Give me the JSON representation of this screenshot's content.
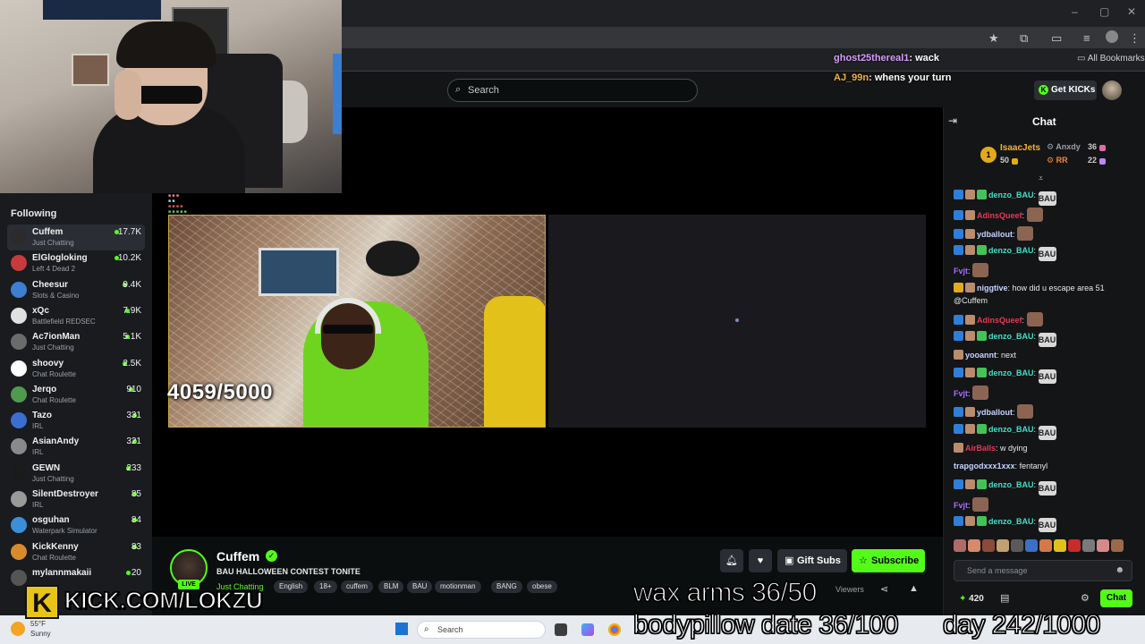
{
  "browser": {
    "bookmarks_label": "All Bookmarks",
    "window_controls": [
      "–",
      "▢",
      "✕"
    ]
  },
  "header": {
    "search_placeholder": "Search",
    "get_kicks_label": "Get KICKs"
  },
  "overlay_chat": [
    {
      "user": "ghost25thereal1",
      "message": "wack",
      "user_color": "#d99cff"
    },
    {
      "user": "AJ_99n",
      "message": "whens your turn",
      "user_color": "#f3b23a"
    }
  ],
  "sidebar": {
    "title": "Following",
    "items": [
      {
        "name": "Cuffem",
        "category": "Just Chatting",
        "viewers": "17.7K",
        "active": true,
        "avatar_color": "#2b2b2b"
      },
      {
        "name": "ElGlogloking",
        "category": "Left 4 Dead 2",
        "viewers": "10.2K",
        "avatar_color": "#c93a3a"
      },
      {
        "name": "Cheesur",
        "category": "Slots & Casino",
        "viewers": "9.4K",
        "avatar_color": "#3d7fd1"
      },
      {
        "name": "xQc",
        "category": "Battlefield REDSEC",
        "viewers": "7.9K",
        "avatar_color": "#e0e0e0"
      },
      {
        "name": "Ac7ionMan",
        "category": "Just Chatting",
        "viewers": "5.1K",
        "avatar_color": "#6b6b6b"
      },
      {
        "name": "shoovy",
        "category": "Chat Roulette",
        "viewers": "2.5K",
        "avatar_color": "#ffffff"
      },
      {
        "name": "Jerqo",
        "category": "Chat Roulette",
        "viewers": "910",
        "avatar_color": "#4f9a4f"
      },
      {
        "name": "Tazo",
        "category": "IRL",
        "viewers": "331",
        "avatar_color": "#3a6fd1"
      },
      {
        "name": "AsianAndy",
        "category": "IRL",
        "viewers": "321",
        "avatar_color": "#8a8a8a"
      },
      {
        "name": "GEWN",
        "category": "Just Chatting",
        "viewers": "233",
        "avatar_color": "#1a1a1a"
      },
      {
        "name": "SilentDestroyer",
        "category": "IRL",
        "viewers": "85",
        "avatar_color": "#9a9a9a"
      },
      {
        "name": "osguhan",
        "category": "Waterpark Simulator",
        "viewers": "84",
        "avatar_color": "#3b8fd9"
      },
      {
        "name": "KickKenny",
        "category": "Chat Roulette",
        "viewers": "83",
        "avatar_color": "#d98a2b"
      },
      {
        "name": "mylannmakaii",
        "category": "",
        "viewers": "20",
        "avatar_color": "#555555"
      }
    ]
  },
  "player": {
    "counter_text": "4059/5000"
  },
  "stream_info": {
    "channel_name": "Cuffem",
    "live_label": "LIVE",
    "title": "BAU HALLOWEEN CONTEST TONITE",
    "category": "Just Chatting",
    "tags": [
      "English",
      "18+",
      "cuffem",
      "BLM",
      "BAU",
      "motionman",
      "BANG",
      "obese"
    ],
    "gift_subs_label": "Gift Subs",
    "subscribe_label": "Subscribe",
    "viewers_label": "Viewers"
  },
  "chat": {
    "title": "Chat",
    "top_gifters": [
      {
        "name": "IsaacJets",
        "count": "50",
        "color": "#f3b23a"
      },
      {
        "name": "Anxdy",
        "count": "36",
        "color": "#9aa0a6"
      },
      {
        "name": "RR",
        "count": "22",
        "color": "#f08a3a"
      }
    ],
    "rank_badge": "1",
    "messages": [
      {
        "user": "denzo_BAU",
        "text": "",
        "user_class": "u-teal",
        "emote": "BAU"
      },
      {
        "user": "AdinsQueef",
        "text": "",
        "user_class": "u-red",
        "emote": "img"
      },
      {
        "user": "ydballout",
        "text": "",
        "user_class": "u-white",
        "emote": "img"
      },
      {
        "user": "denzo_BAU",
        "text": "",
        "user_class": "u-teal",
        "emote": "BAU"
      },
      {
        "user": "Fvjt",
        "text": "",
        "user_class": "u-purple",
        "emote": "img"
      },
      {
        "user": "niggtive",
        "text": "how did u escape area 51 @Cuffem",
        "user_class": "u-white",
        "emote": ""
      },
      {
        "user": "AdinsQueef",
        "text": "",
        "user_class": "u-red",
        "emote": "img"
      },
      {
        "user": "denzo_BAU",
        "text": "",
        "user_class": "u-teal",
        "emote": "BAU"
      },
      {
        "user": "yooannt",
        "text": "next",
        "user_class": "u-white",
        "emote": ""
      },
      {
        "user": "denzo_BAU",
        "text": "",
        "user_class": "u-teal",
        "emote": "BAU"
      },
      {
        "user": "Fvjt",
        "text": "",
        "user_class": "u-purple",
        "emote": "img"
      },
      {
        "user": "ydballout",
        "text": "",
        "user_class": "u-white",
        "emote": "img"
      },
      {
        "user": "denzo_BAU",
        "text": "",
        "user_class": "u-teal",
        "emote": "BAU"
      },
      {
        "user": "AirBalls",
        "text": "w dying",
        "user_class": "u-red",
        "emote": ""
      },
      {
        "user": "trapgodxxx1xxx",
        "text": "fentanyl",
        "user_class": "u-white",
        "emote": ""
      },
      {
        "user": "denzo_BAU",
        "text": "",
        "user_class": "u-teal",
        "emote": "BAU"
      },
      {
        "user": "Fvjt",
        "text": "",
        "user_class": "u-purple",
        "emote": "img"
      },
      {
        "user": "denzo_BAU",
        "text": "",
        "user_class": "u-teal",
        "emote": "BAU"
      }
    ],
    "input_placeholder": "Send a message",
    "kicks_count": "420",
    "chat_button_label": "Chat"
  },
  "overlays": {
    "kick_url": "KICK.COM/LOKZU",
    "kick_logo_letter": "K",
    "wax_arms": "wax arms 36/50",
    "bodypillow": "bodypillow date 36/100",
    "day_counter": "day 242/1000"
  },
  "taskbar": {
    "temperature": "55°F",
    "weather": "Sunny",
    "search_label": "Search"
  }
}
